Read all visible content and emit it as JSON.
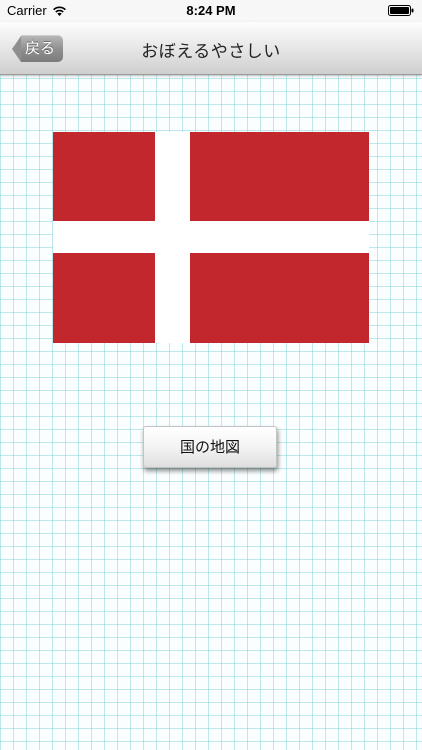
{
  "status_bar": {
    "carrier": "Carrier",
    "time": "8:24 PM",
    "wifi_icon": "wifi-icon",
    "battery_icon": "battery-icon"
  },
  "nav": {
    "back_label": "戻る",
    "title": "おぼえるやさしい"
  },
  "flag": {
    "icon": "denmark-flag",
    "colors": {
      "field": "#c1272d",
      "cross": "#ffffff"
    }
  },
  "map_button": {
    "label": "国の地図"
  },
  "colors": {
    "grid_line": "#78cdd7",
    "background": "#fafefe",
    "nav_gradient_top": "#fdfdfd",
    "nav_gradient_bottom": "#cfcfcf",
    "back_button": "#8e8e8e"
  }
}
